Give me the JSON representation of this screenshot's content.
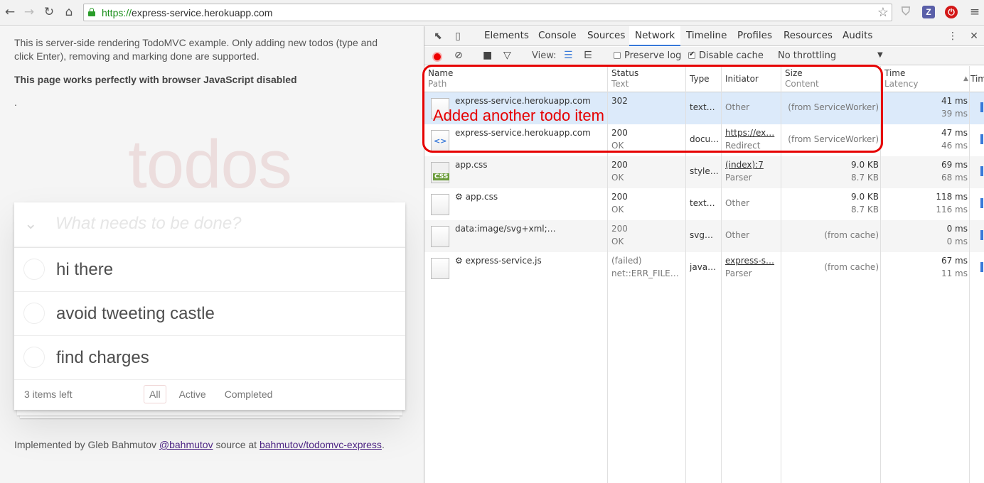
{
  "browser": {
    "url_scheme": "https://",
    "url_host": "express-service.herokuapp.com"
  },
  "page": {
    "intro": "This is server-side rendering TodoMVC example. Only adding new todos (type and click Enter), removing and marking done are supported.",
    "bold_note": "This page works perfectly with browser JavaScript disabled",
    "dot": ".",
    "title": "todos",
    "new_todo_placeholder": "What needs to be done?",
    "todos": [
      {
        "label": "hi there"
      },
      {
        "label": "avoid tweeting castle"
      },
      {
        "label": "find charges"
      }
    ],
    "footer": {
      "count": "3 items left",
      "filters": {
        "all": "All",
        "active": "Active",
        "completed": "Completed"
      }
    },
    "credits": {
      "prefix": "Implemented by Gleb Bahmutov ",
      "twitter": "@bahmutov",
      "middle": " source at ",
      "repo": "bahmutov/todomvc-express",
      "suffix": "."
    }
  },
  "devtools": {
    "tabs": {
      "elements": "Elements",
      "console": "Console",
      "sources": "Sources",
      "network": "Network",
      "timeline": "Timeline",
      "profiles": "Profiles",
      "resources": "Resources",
      "audits": "Audits"
    },
    "active_tab": "Network",
    "toolbar": {
      "view_label": "View:",
      "preserve_log": "Preserve log",
      "disable_cache": "Disable cache",
      "throttling": "No throttling"
    },
    "columns": {
      "name": "Name",
      "path": "Path",
      "status": "Status",
      "text": "Text",
      "type": "Type",
      "initiator": "Initiator",
      "size": "Size",
      "content": "Content",
      "time": "Time",
      "latency": "Latency",
      "timeline": "Tim"
    },
    "rows": [
      {
        "name": "express-service.herokuapp.com",
        "status": "302",
        "status_text": "",
        "type": "text…",
        "initiator": "Other",
        "initiator_sub": "",
        "size": "(from ServiceWorker)",
        "content": "",
        "time": "41 ms",
        "latency": "39 ms",
        "icon": "doc"
      },
      {
        "name": "express-service.herokuapp.com",
        "status": "200",
        "status_text": "OK",
        "type": "docu…",
        "initiator": "https://ex…",
        "initiator_sub": "Redirect",
        "size": "(from ServiceWorker)",
        "content": "",
        "time": "47 ms",
        "latency": "46 ms",
        "icon": "html"
      },
      {
        "name": "app.css",
        "status": "200",
        "status_text": "OK",
        "type": "style…",
        "initiator": "(index):7",
        "initiator_sub": "Parser",
        "size": "9.0 KB",
        "content": "8.7 KB",
        "time": "69 ms",
        "latency": "68 ms",
        "icon": "css"
      },
      {
        "name": "⚙ app.css",
        "status": "200",
        "status_text": "OK",
        "type": "text…",
        "initiator": "Other",
        "initiator_sub": "",
        "size": "9.0 KB",
        "content": "8.7 KB",
        "time": "118 ms",
        "latency": "116 ms",
        "icon": "doc"
      },
      {
        "name": "data:image/svg+xml;…",
        "status": "200",
        "status_text": "OK",
        "type": "svg…",
        "initiator": "Other",
        "initiator_sub": "",
        "size": "(from cache)",
        "content": "",
        "time": "0 ms",
        "latency": "0 ms",
        "icon": "doc"
      },
      {
        "name": "⚙ express-service.js",
        "status": "(failed)",
        "status_text": "net::ERR_FILE_…",
        "type": "java…",
        "initiator": "express-s…",
        "initiator_sub": "Parser",
        "size": "(from cache)",
        "content": "",
        "time": "67 ms",
        "latency": "11 ms",
        "icon": "doc"
      }
    ],
    "annotation": "Added another todo item"
  },
  "colors": {
    "accent": "#3879d9",
    "annotation": "#e60000",
    "selected_row": "#dceafa"
  }
}
